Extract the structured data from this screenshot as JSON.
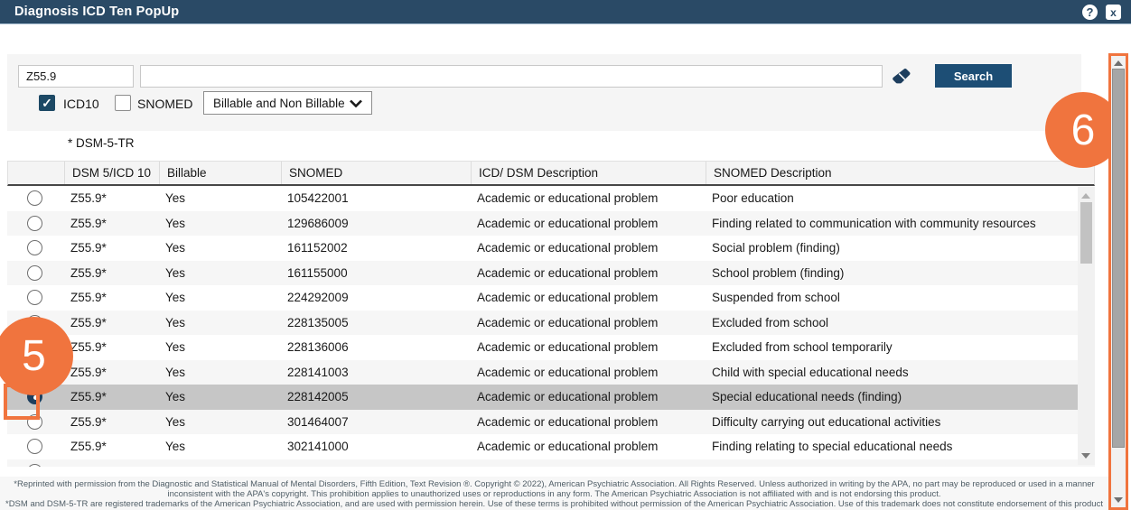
{
  "header": {
    "title": "Diagnosis ICD Ten PopUp",
    "help_icon": "?",
    "close_icon": "x"
  },
  "search": {
    "code_value": "Z55.9",
    "query_value": "",
    "search_label": "Search",
    "icd10_label": "ICD10",
    "icd10_checked": true,
    "snomed_label": "SNOMED",
    "snomed_checked": false,
    "filter_value": "Billable and Non Billable"
  },
  "table": {
    "note": "* DSM-5-TR",
    "columns": [
      "",
      "DSM 5/ICD 10",
      "Billable",
      "SNOMED",
      "ICD/ DSM Description",
      "SNOMED Description"
    ],
    "rows": [
      {
        "code": "Z55.9*",
        "billable": "Yes",
        "snomed": "105422001",
        "icd_desc": "Academic or educational problem",
        "snomed_desc": "Poor education",
        "selected": false
      },
      {
        "code": "Z55.9*",
        "billable": "Yes",
        "snomed": "129686009",
        "icd_desc": "Academic or educational problem",
        "snomed_desc": "Finding related to communication with community resources",
        "selected": false
      },
      {
        "code": "Z55.9*",
        "billable": "Yes",
        "snomed": "161152002",
        "icd_desc": "Academic or educational problem",
        "snomed_desc": "Social problem (finding)",
        "selected": false
      },
      {
        "code": "Z55.9*",
        "billable": "Yes",
        "snomed": "161155000",
        "icd_desc": "Academic or educational problem",
        "snomed_desc": "School problem (finding)",
        "selected": false
      },
      {
        "code": "Z55.9*",
        "billable": "Yes",
        "snomed": "224292009",
        "icd_desc": "Academic or educational problem",
        "snomed_desc": "Suspended from school",
        "selected": false
      },
      {
        "code": "Z55.9*",
        "billable": "Yes",
        "snomed": "228135005",
        "icd_desc": "Academic or educational problem",
        "snomed_desc": "Excluded from school",
        "selected": false
      },
      {
        "code": "Z55.9*",
        "billable": "Yes",
        "snomed": "228136006",
        "icd_desc": "Academic or educational problem",
        "snomed_desc": "Excluded from school temporarily",
        "selected": false
      },
      {
        "code": "Z55.9*",
        "billable": "Yes",
        "snomed": "228141003",
        "icd_desc": "Academic or educational problem",
        "snomed_desc": "Child with special educational needs",
        "selected": false
      },
      {
        "code": "Z55.9*",
        "billable": "Yes",
        "snomed": "228142005",
        "icd_desc": "Academic or educational problem",
        "snomed_desc": "Special educational needs (finding)",
        "selected": true
      },
      {
        "code": "Z55.9*",
        "billable": "Yes",
        "snomed": "301464007",
        "icd_desc": "Academic or educational problem",
        "snomed_desc": "Difficulty carrying out educational activities",
        "selected": false
      },
      {
        "code": "Z55.9*",
        "billable": "Yes",
        "snomed": "302141000",
        "icd_desc": "Academic or educational problem",
        "snomed_desc": "Finding relating to special educational needs",
        "selected": false
      }
    ],
    "partial_row": true
  },
  "annotations": {
    "step_5": "5",
    "step_6": "6"
  },
  "footer": {
    "line1": "*Reprinted with permission from the Diagnostic and Statistical Manual of Mental Disorders, Fifth Edition, Text Revision ®. Copyright © 2022), American Psychiatric Association. All Rights Reserved. Unless authorized in writing by the APA, no part may be reproduced or used in a manner",
    "line2": "inconsistent with the APA's copyright. This prohibition applies to unauthorized uses or reproductions in any form. The American Psychiatric Association is not affiliated with and is not endorsing this product.",
    "line3": "*DSM and DSM-5-TR are registered trademarks of the American Psychiatric Association, and are used with permission herein. Use of these terms is prohibited without permission of the American Psychiatric Association. Use of this trademark does not constitute endorsement of this product"
  },
  "colors": {
    "titlebar_navy": "#2a4a66",
    "button_navy": "#1d4e75",
    "checked_navy": "#1d4965",
    "radio_navy": "#1d3e5e",
    "accent_orange": "#f0743e",
    "selected_row_gray": "#c6c6c6"
  }
}
